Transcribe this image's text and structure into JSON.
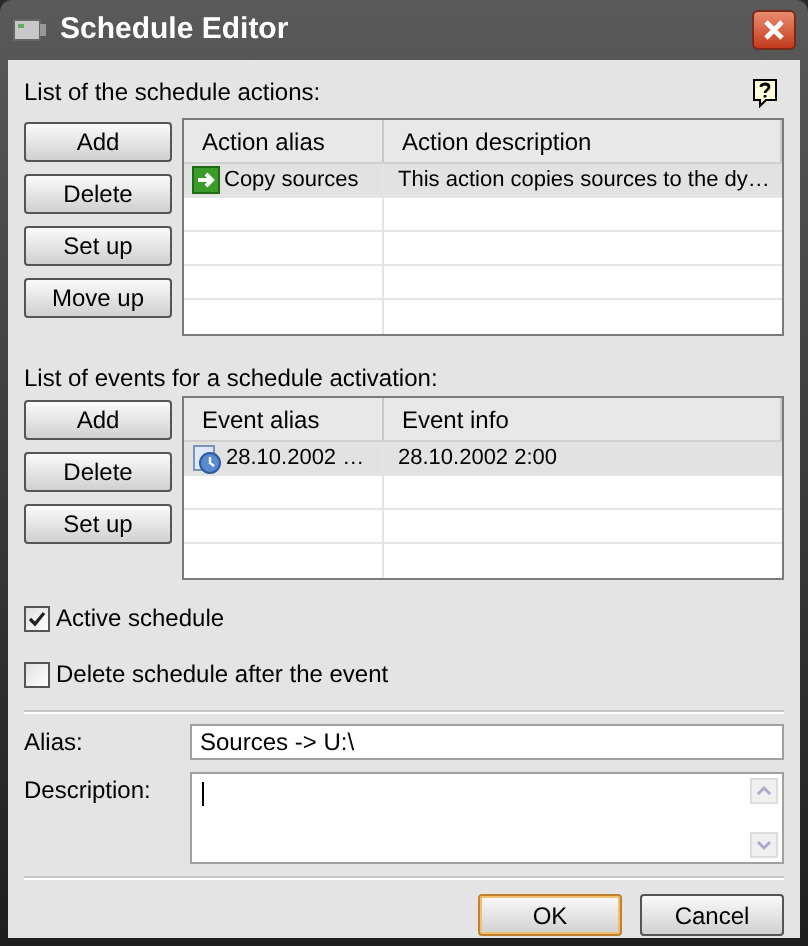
{
  "window": {
    "title": "Schedule Editor"
  },
  "actions_section": {
    "label": "List of the schedule actions:",
    "buttons": [
      "Add",
      "Delete",
      "Set up",
      "Move up"
    ],
    "table": {
      "columns": [
        "Action alias",
        "Action description"
      ],
      "rows": [
        {
          "cells": [
            "Copy sources",
            "This action copies sources to the dy…"
          ],
          "selected": true
        }
      ]
    }
  },
  "events_section": {
    "label": "List of events for a schedule activation:",
    "buttons": [
      "Add",
      "Delete",
      "Set up"
    ],
    "table": {
      "columns": [
        "Event alias",
        "Event info"
      ],
      "rows": [
        {
          "cells": [
            "28.10.2002 …",
            "28.10.2002 2:00"
          ],
          "selected": true
        }
      ]
    }
  },
  "options": [
    {
      "label": "Active schedule",
      "checked": true
    },
    {
      "label": "Delete schedule after the event",
      "checked": false
    }
  ],
  "alias": {
    "label": "Alias:",
    "value": "Sources -> U:\\"
  },
  "description": {
    "label": "Description:"
  },
  "buttons": [
    {
      "label": "OK",
      "default": true
    },
    {
      "label": "Cancel",
      "default": false
    }
  ]
}
